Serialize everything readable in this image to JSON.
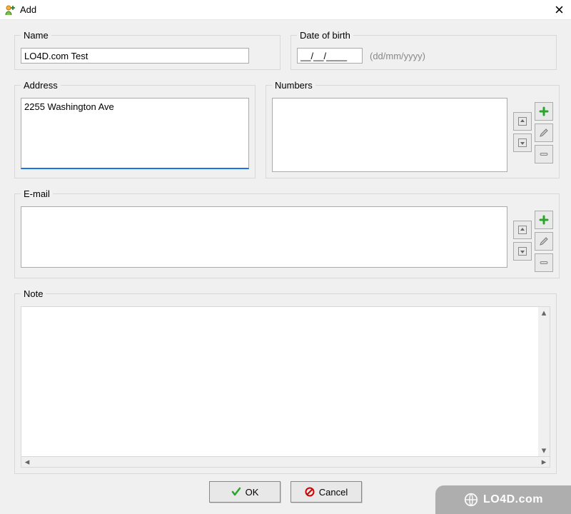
{
  "window": {
    "title": "Add"
  },
  "groups": {
    "name": {
      "label": "Name",
      "value": "LO4D.com Test"
    },
    "dob": {
      "label": "Date of birth",
      "value": "__/__/____",
      "hint": "(dd/mm/yyyy)"
    },
    "address": {
      "label": "Address",
      "value": "2255 Washington Ave"
    },
    "numbers": {
      "label": "Numbers",
      "items": []
    },
    "email": {
      "label": "E-mail",
      "items": []
    },
    "note": {
      "label": "Note",
      "value": ""
    }
  },
  "icons": {
    "up": "arrow-up-icon",
    "down": "arrow-down-icon",
    "add": "plus-icon",
    "edit": "pencil-icon",
    "remove": "minus-icon"
  },
  "buttons": {
    "ok": "OK",
    "cancel": "Cancel"
  },
  "watermark": "LO4D.com"
}
